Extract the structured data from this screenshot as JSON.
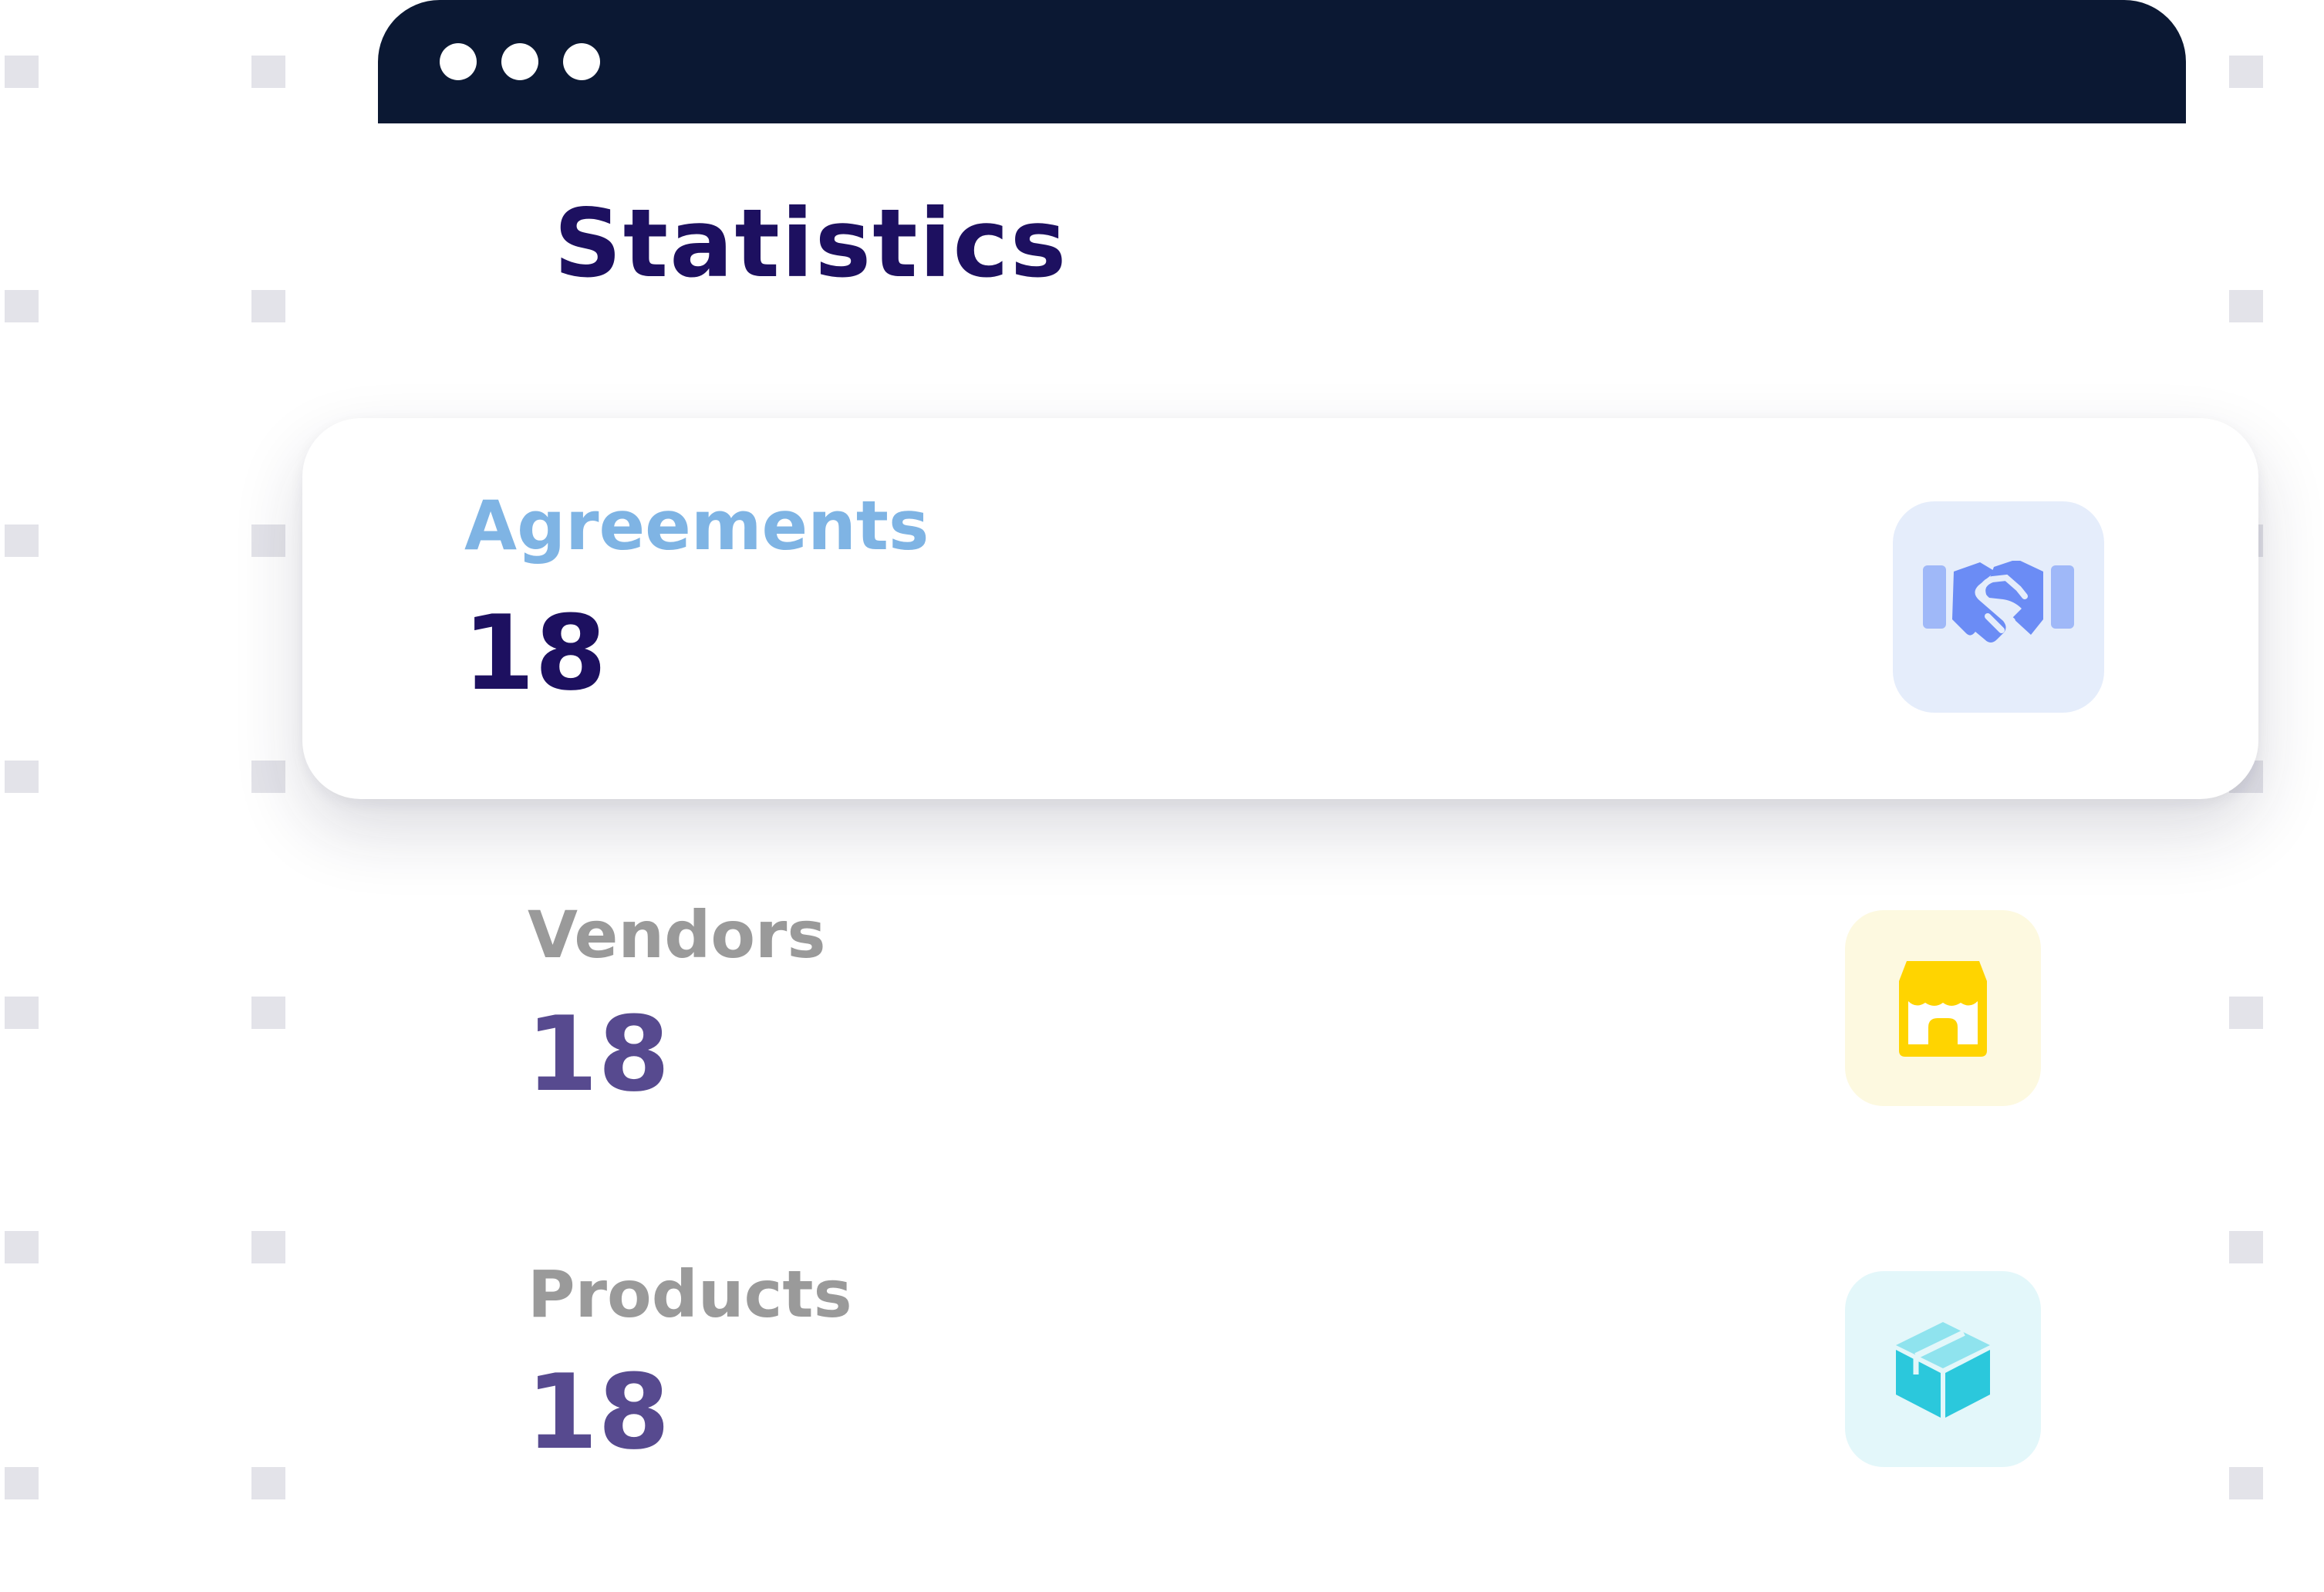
{
  "page": {
    "title": "Statistics"
  },
  "window": {
    "titlebar_color": "#0b1833",
    "controls": [
      "window-dot",
      "window-dot",
      "window-dot"
    ]
  },
  "stats": [
    {
      "label": "Agreements",
      "value": "18",
      "icon": "handshake-icon",
      "highlighted": true,
      "label_color": "#7fb4e4",
      "value_color": "#1d1060",
      "tile_color": "#e5edfb",
      "icon_color": "#6b8cf5"
    },
    {
      "label": "Vendors",
      "value": "18",
      "icon": "store-icon",
      "highlighted": false,
      "label_color": "#9a9a9a",
      "value_color": "#574a8f",
      "tile_color": "#fdf9e0",
      "icon_color": "#ffd400"
    },
    {
      "label": "Products",
      "value": "18",
      "icon": "box-icon",
      "highlighted": false,
      "label_color": "#9a9a9a",
      "value_color": "#574a8f",
      "tile_color": "#e3f7fa",
      "icon_color": "#2bc8dc"
    }
  ]
}
